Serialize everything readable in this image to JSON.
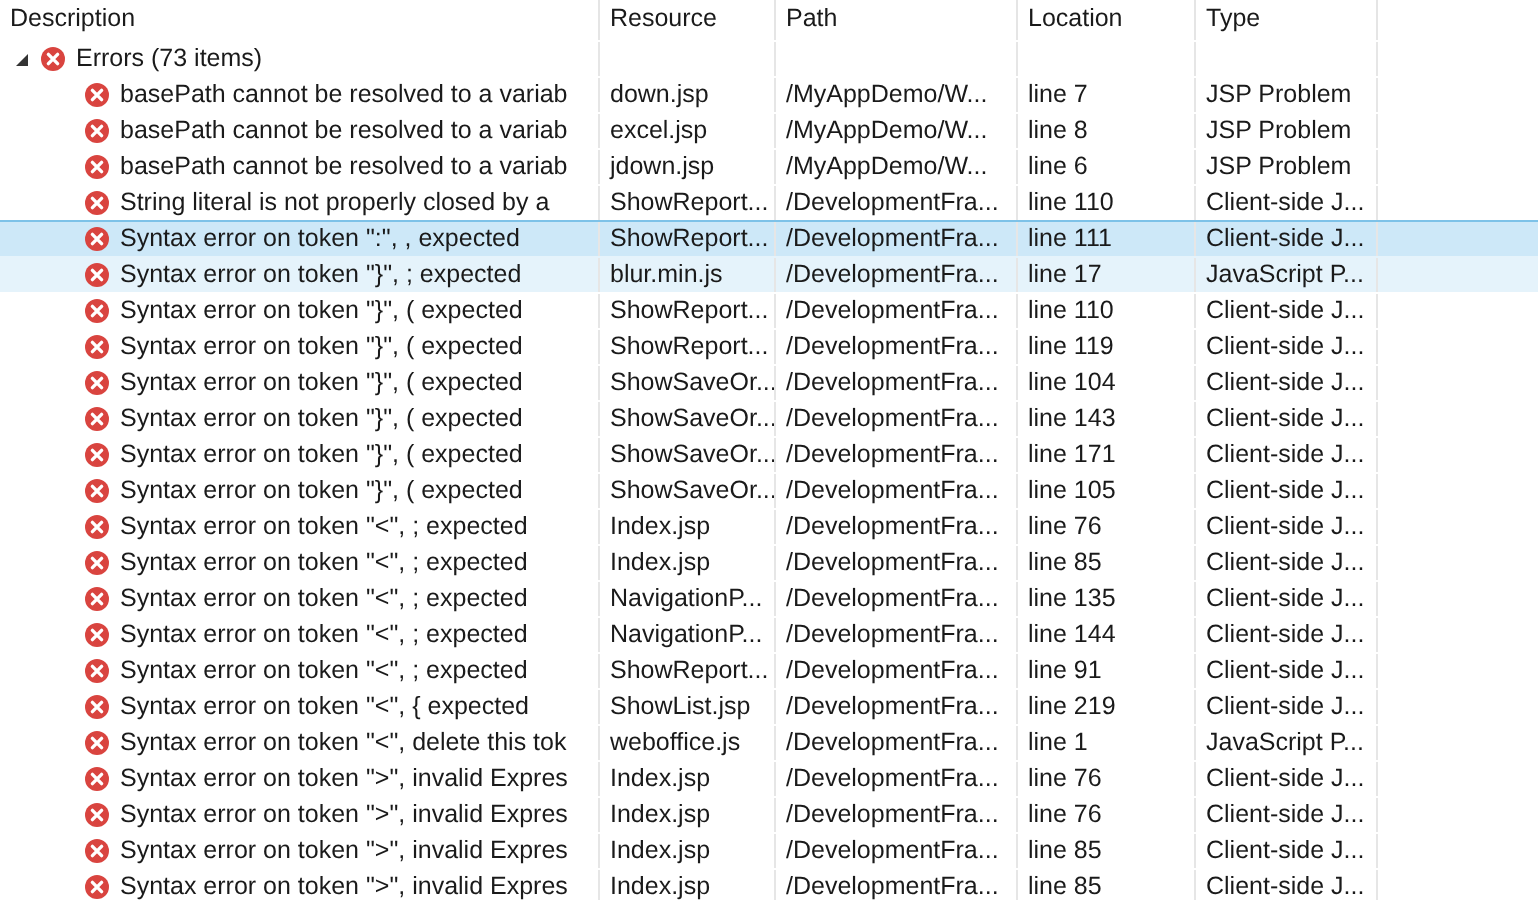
{
  "columns": [
    "Description",
    "Resource",
    "Path",
    "Location",
    "Type"
  ],
  "group": {
    "label": "Errors (73 items)",
    "expanded": true
  },
  "rows": [
    {
      "description": "basePath cannot be resolved to a variab",
      "resource": "down.jsp",
      "path": "/MyAppDemo/W...",
      "location": "line 7",
      "type": "JSP Problem",
      "selected": false,
      "hovered": false
    },
    {
      "description": "basePath cannot be resolved to a variab",
      "resource": "excel.jsp",
      "path": "/MyAppDemo/W...",
      "location": "line 8",
      "type": "JSP Problem",
      "selected": false,
      "hovered": false
    },
    {
      "description": "basePath cannot be resolved to a variab",
      "resource": "jdown.jsp",
      "path": "/MyAppDemo/W...",
      "location": "line 6",
      "type": "JSP Problem",
      "selected": false,
      "hovered": false
    },
    {
      "description": "String literal is not properly closed by a",
      "resource": "ShowReport...",
      "path": "/DevelopmentFra...",
      "location": "line 110",
      "type": "Client-side J...",
      "selected": false,
      "hovered": false
    },
    {
      "description": "Syntax error on token \":\", , expected",
      "resource": "ShowReport...",
      "path": "/DevelopmentFra...",
      "location": "line 111",
      "type": "Client-side J...",
      "selected": true,
      "hovered": false
    },
    {
      "description": "Syntax error on token \"}\", ; expected",
      "resource": "blur.min.js",
      "path": "/DevelopmentFra...",
      "location": "line 17",
      "type": "JavaScript P...",
      "selected": false,
      "hovered": true
    },
    {
      "description": "Syntax error on token \"}\", ( expected",
      "resource": "ShowReport...",
      "path": "/DevelopmentFra...",
      "location": "line 110",
      "type": "Client-side J...",
      "selected": false,
      "hovered": false
    },
    {
      "description": "Syntax error on token \"}\", ( expected",
      "resource": "ShowReport...",
      "path": "/DevelopmentFra...",
      "location": "line 119",
      "type": "Client-side J...",
      "selected": false,
      "hovered": false
    },
    {
      "description": "Syntax error on token \"}\", ( expected",
      "resource": "ShowSaveOr...",
      "path": "/DevelopmentFra...",
      "location": "line 104",
      "type": "Client-side J...",
      "selected": false,
      "hovered": false
    },
    {
      "description": "Syntax error on token \"}\", ( expected",
      "resource": "ShowSaveOr...",
      "path": "/DevelopmentFra...",
      "location": "line 143",
      "type": "Client-side J...",
      "selected": false,
      "hovered": false
    },
    {
      "description": "Syntax error on token \"}\", ( expected",
      "resource": "ShowSaveOr...",
      "path": "/DevelopmentFra...",
      "location": "line 171",
      "type": "Client-side J...",
      "selected": false,
      "hovered": false
    },
    {
      "description": "Syntax error on token \"}\", ( expected",
      "resource": "ShowSaveOr...",
      "path": "/DevelopmentFra...",
      "location": "line 105",
      "type": "Client-side J...",
      "selected": false,
      "hovered": false
    },
    {
      "description": "Syntax error on token \"<\", ; expected",
      "resource": "Index.jsp",
      "path": "/DevelopmentFra...",
      "location": "line 76",
      "type": "Client-side J...",
      "selected": false,
      "hovered": false
    },
    {
      "description": "Syntax error on token \"<\", ; expected",
      "resource": "Index.jsp",
      "path": "/DevelopmentFra...",
      "location": "line 85",
      "type": "Client-side J...",
      "selected": false,
      "hovered": false
    },
    {
      "description": "Syntax error on token \"<\", ; expected",
      "resource": "NavigationP...",
      "path": "/DevelopmentFra...",
      "location": "line 135",
      "type": "Client-side J...",
      "selected": false,
      "hovered": false
    },
    {
      "description": "Syntax error on token \"<\", ; expected",
      "resource": "NavigationP...",
      "path": "/DevelopmentFra...",
      "location": "line 144",
      "type": "Client-side J...",
      "selected": false,
      "hovered": false
    },
    {
      "description": "Syntax error on token \"<\", ; expected",
      "resource": "ShowReport...",
      "path": "/DevelopmentFra...",
      "location": "line 91",
      "type": "Client-side J...",
      "selected": false,
      "hovered": false
    },
    {
      "description": "Syntax error on token \"<\", { expected",
      "resource": "ShowList.jsp",
      "path": "/DevelopmentFra...",
      "location": "line 219",
      "type": "Client-side J...",
      "selected": false,
      "hovered": false
    },
    {
      "description": "Syntax error on token \"<\", delete this tok",
      "resource": "weboffice.js",
      "path": "/DevelopmentFra...",
      "location": "line 1",
      "type": "JavaScript P...",
      "selected": false,
      "hovered": false
    },
    {
      "description": "Syntax error on token \">\", invalid Expres",
      "resource": "Index.jsp",
      "path": "/DevelopmentFra...",
      "location": "line 76",
      "type": "Client-side J...",
      "selected": false,
      "hovered": false
    },
    {
      "description": "Syntax error on token \">\", invalid Expres",
      "resource": "Index.jsp",
      "path": "/DevelopmentFra...",
      "location": "line 76",
      "type": "Client-side J...",
      "selected": false,
      "hovered": false
    },
    {
      "description": "Syntax error on token \">\", invalid Expres",
      "resource": "Index.jsp",
      "path": "/DevelopmentFra...",
      "location": "line 85",
      "type": "Client-side J...",
      "selected": false,
      "hovered": false
    },
    {
      "description": "Syntax error on token \">\", invalid Expres",
      "resource": "Index.jsp",
      "path": "/DevelopmentFra...",
      "location": "line 85",
      "type": "Client-side J...",
      "selected": false,
      "hovered": false
    }
  ]
}
